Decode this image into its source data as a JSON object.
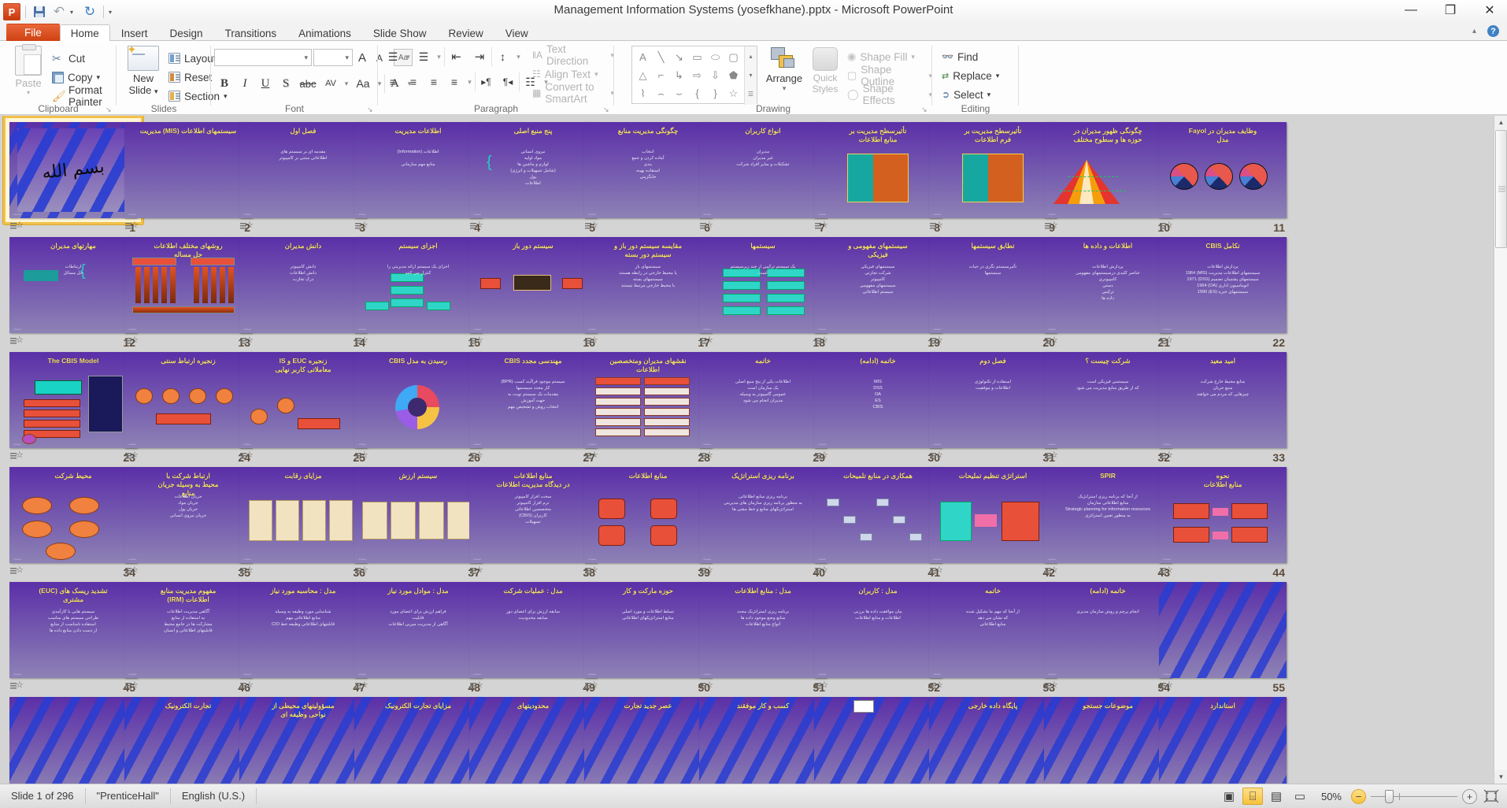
{
  "window": {
    "title": "Management Information Systems (yosefkhane).pptx  -  Microsoft PowerPoint",
    "minimize": "—",
    "restore": "❐",
    "close": "✕"
  },
  "qat": {
    "app_logo": "P",
    "save": "save-icon",
    "undo": "↶",
    "undo_caret": "▾",
    "redo": "↻",
    "customize": "▾"
  },
  "ribbon": {
    "help_collapse": "▴",
    "help": "?",
    "tabs": [
      {
        "label": "File",
        "active": false,
        "kind": "file"
      },
      {
        "label": "Home",
        "active": true,
        "kind": "normal"
      },
      {
        "label": "Insert",
        "active": false,
        "kind": "normal"
      },
      {
        "label": "Design",
        "active": false,
        "kind": "normal"
      },
      {
        "label": "Transitions",
        "active": false,
        "kind": "normal"
      },
      {
        "label": "Animations",
        "active": false,
        "kind": "normal"
      },
      {
        "label": "Slide Show",
        "active": false,
        "kind": "normal"
      },
      {
        "label": "Review",
        "active": false,
        "kind": "normal"
      },
      {
        "label": "View",
        "active": false,
        "kind": "normal"
      }
    ],
    "groups": {
      "clipboard": {
        "label": "Clipboard",
        "paste": "Paste",
        "paste_caret": "▾",
        "cut": "Cut",
        "copy": "Copy",
        "copy_caret": "▾",
        "format_painter": "Format Painter",
        "dialog_launcher": "↘"
      },
      "slides": {
        "label": "Slides",
        "new_slide": "New",
        "new_slide2": "Slide",
        "new_slide_caret": "▾",
        "layout": "Layout",
        "layout_caret": "▾",
        "reset": "Reset",
        "section": "Section",
        "section_caret": "▾"
      },
      "font": {
        "label": "Font",
        "font_name_value": "",
        "font_size_value": "",
        "caret": "▾",
        "grow_font": "A",
        "shrink_font": "A",
        "clear_formatting": "Aa",
        "bold": "B",
        "italic": "I",
        "underline": "U",
        "shadow": "S",
        "strikethrough": "abc",
        "character_spacing": "AV",
        "change_case": "Aa",
        "font_color": "A",
        "dialog_launcher": "↘"
      },
      "paragraph": {
        "label": "Paragraph",
        "bullets": "☰",
        "numbering": "☰",
        "decrease_indent": "⇤",
        "increase_indent": "⇥",
        "line_spacing": "↕",
        "align_left": "≡",
        "align_center": "≡",
        "align_right": "≡",
        "justify": "≡",
        "ltr": "▸¶",
        "rtl": "¶◂",
        "columns": "☷",
        "text_direction": "Text Direction",
        "align_text": "Align Text",
        "convert_to_smartart": "Convert to SmartArt",
        "caret": "▾",
        "dialog_launcher": "↘"
      },
      "drawing": {
        "label": "Drawing",
        "shapes": [
          "textbox-shape",
          "line-shape",
          "arrow-shape",
          "rectangle-shape",
          "oval-shape",
          "rounded-rect-shape",
          "triangle-shape",
          "elbow-connector-shape",
          "elbow-arrow-shape",
          "right-arrow-shape",
          "down-arrow-shape",
          "pentagon-shape",
          "freeform-shape",
          "curve-shape",
          "arc-shape",
          "left-brace-shape",
          "right-brace-shape",
          "star-shape"
        ],
        "scroll_up": "▴",
        "scroll_down": "▾",
        "more": "☰",
        "arrange": "Arrange",
        "arrange_caret": "▾",
        "quick_styles": "Quick",
        "quick_styles2": "Styles",
        "quick_styles_caret": "▾",
        "shape_fill": "Shape Fill",
        "shape_outline": "Shape Outline",
        "shape_effects": "Shape Effects",
        "caret": "▾",
        "dialog_launcher": "↘"
      },
      "editing": {
        "label": "Editing",
        "find": "Find",
        "replace": "Replace",
        "select": "Select",
        "caret": "▾"
      }
    }
  },
  "status": {
    "slide_count": "Slide 1 of 296",
    "theme": "\"PrenticeHall\"",
    "language": "English (U.S.)",
    "views": [
      {
        "name": "normal-view-button",
        "glyph": "▣",
        "active": false
      },
      {
        "name": "slide-sorter-view-button",
        "glyph": "⌸",
        "active": true
      },
      {
        "name": "reading-view-button",
        "glyph": "▤",
        "active": false
      },
      {
        "name": "slide-show-button",
        "glyph": "▭",
        "active": false
      }
    ],
    "zoom_level": "50%",
    "zoom_out": "−",
    "zoom_in": "+",
    "fit_to_window": "⤢"
  },
  "thumbnail_pane": {
    "columns": 11,
    "selected_slide": 1,
    "scrollbar": {
      "up": "▲",
      "down": "▼"
    },
    "slides": [
      {
        "n": 1,
        "title": "",
        "body": "",
        "art": "calligraphy",
        "stripes": true,
        "selected": true
      },
      {
        "n": 2,
        "title": "سیستمهای اطلاعات (MIS) مدیریت",
        "body": "",
        "art": "none",
        "stripes": false
      },
      {
        "n": 3,
        "title": "فصل اول",
        "body": "مقدمه ای بر سیستم های\nاطلاعاتی مبتنی بر کامپیوتر",
        "art": "none",
        "stripes": false
      },
      {
        "n": 4,
        "title": "اطلاعات مدیریت",
        "body": "اطلاعات (Information)\n\nمنابع مهم سازمانی",
        "art": "none",
        "stripes": false
      },
      {
        "n": 5,
        "title": "پنج منبع اصلی",
        "body": "نیروی انسانی\nمواد اولیه\nلوازم و ماشین ها\n(شامل تسهیلات و انرژی)\nپول\nاطلاعات",
        "art": "brace",
        "stripes": false
      },
      {
        "n": 6,
        "title": "چگونگی مدیریت منابع",
        "body": "انتخاب\nآماده کردن و جمع\nبندی\nاستفاده بهینه\nجایگزینی",
        "art": "none",
        "stripes": false
      },
      {
        "n": 7,
        "title": "انواع کاربران",
        "body": "مدیران\nغیر مدیران\nتشکیلات و سایر افراد شرکت",
        "art": "none",
        "stripes": false
      },
      {
        "n": 8,
        "title": "تأثیرسطح مدیریت بر\nمنابع اطلاعات",
        "body": "",
        "art": "matrix",
        "stripes": false
      },
      {
        "n": 9,
        "title": "تأثیرسطح مدیریت بر\nفرم اطلاعات",
        "body": "",
        "art": "matrix",
        "stripes": false
      },
      {
        "n": 10,
        "title": "چگونگی ظهور مدیران در\nحوزه ها و سطوح مختلف",
        "body": "",
        "art": "pyramid",
        "stripes": false
      },
      {
        "n": 11,
        "title": "وظایف مدیران در Fayol\nمدل",
        "body": "",
        "art": "pies",
        "stripes": false
      },
      {
        "n": 12,
        "title": "مهارتهای مدیران",
        "body": "ارتباطات\nحل مسائل",
        "art": "brace2",
        "stripes": false
      },
      {
        "n": 13,
        "title": "روشهای مختلف اطلاعات\nحل مساله",
        "body": "",
        "art": "rockets",
        "stripes": false
      },
      {
        "n": 14,
        "title": "دانش مدیران",
        "body": "دانش کامپیوتر\nدانش اطلاعات\nدرک تجارت",
        "art": "none",
        "stripes": false
      },
      {
        "n": 15,
        "title": "اجزای سیستم",
        "body": "اجزای یک سیستم ارائه مدیریتی را\nکنترل می کنند",
        "art": "org",
        "stripes": false
      },
      {
        "n": 16,
        "title": "سیستم دور باز",
        "body": "",
        "art": "flow",
        "stripes": false
      },
      {
        "n": 17,
        "title": "مقایسه سیستم دور باز و\nسیستم دور بسته",
        "body": "سیستمهای باز\nیا محیط خارجی در رابطه هستند\nسیستمهای بسته\nبا محیط خارجی مرتبط نیستند",
        "art": "none",
        "stripes": false
      },
      {
        "n": 18,
        "title": "سیستمها",
        "body": "یک سیستم ترکیبی از چند زیرسیستم\nاست",
        "art": "org2",
        "stripes": false
      },
      {
        "n": 19,
        "title": "سیستمهای مفهومی و\nفیزیکی",
        "body": "سیستمهای فیزیکی\nشرکت تجارتی\nکامپیوتر\nسیستمهای مفهومی\nسیستم اطلاعاتی",
        "art": "none",
        "stripes": false
      },
      {
        "n": 20,
        "title": "تطابق سیستمها",
        "body": "تأثیرسیستم نگری در حیات\nسیستمها",
        "art": "none",
        "stripes": false
      },
      {
        "n": 21,
        "title": "اطلاعات و داده ها",
        "body": "پردازش اطلاعات\nعناصر کلیدی درسیستمهای مفهومی\nکامپیوتری\nدستی\nترکیبی\nداده ها",
        "art": "none",
        "stripes": false
      },
      {
        "n": 22,
        "title": "تکامل CBIS",
        "body": "پردازش اطلاعات\nسیستمهای اطلاعات مدیریت (MIS) 1964\nسیستمهای پشتیبان تصمیم (DSS) 1971\nاتوماسیون اداری (OA) 1964\nسیستمهای خبره (ES) 1990",
        "art": "none",
        "stripes": false
      },
      {
        "n": 23,
        "title": "The CBIS Model",
        "body": "",
        "art": "cbis",
        "stripes": false
      },
      {
        "n": 24,
        "title": "زنجیره ارتباط سنتی",
        "body": "",
        "art": "chain",
        "stripes": false
      },
      {
        "n": 25,
        "title": "زنجیره EUC و IS\nمعاملاتی کاربر نهایی",
        "body": "",
        "art": "chain2",
        "stripes": false
      },
      {
        "n": 26,
        "title": "رسیدن به مدل CBIS",
        "body": "",
        "art": "donut",
        "stripes": false
      },
      {
        "n": 27,
        "title": "مهندسی مجدد CBIS",
        "body": "سیستم موجود فراآیند کسب (BPR)\nکار مجدد سیستمها\nمقدمات یک سیستم نوبت به\nجهت آموزش\nانتخاب روش و تشخیص مهم",
        "art": "none",
        "stripes": false
      },
      {
        "n": 28,
        "title": "نقشهای مدیران ومتخصصین\nاطلاعات",
        "body": "",
        "art": "table",
        "stripes": false
      },
      {
        "n": 29,
        "title": "خاتمه",
        "body": "اطلاعات یکی از پنج منبع اصلی\nیک سازمان است\nعمومی گامپیوتر به وسیله\nمدیران انجام می شود",
        "art": "none",
        "stripes": false
      },
      {
        "n": 30,
        "title": "خاتمه (ادامه)",
        "body": "MIS\nDSS\nOA\nES\nCBIS",
        "art": "none",
        "stripes": false
      },
      {
        "n": 31,
        "title": "فصل دوم",
        "body": "استفاده از تکنولوژی\nاطلاعات و موفقیت",
        "art": "none",
        "stripes": false
      },
      {
        "n": 32,
        "title": "شرکت چیست ؟",
        "body": "سیستمی فیزیکی است\nکه از طریق منابع مدیریت می شود",
        "art": "none",
        "stripes": false
      },
      {
        "n": 33,
        "title": "امید معید",
        "body": "منابع محیط خارج شرکت\nمنبع جریان\nچیزهایی که مردم می خواهند",
        "art": "none",
        "stripes": false
      },
      {
        "n": 34,
        "title": "محیط شرکت",
        "body": "",
        "art": "ovals",
        "stripes": false
      },
      {
        "n": 35,
        "title": "ارتباط شرکت با\nمحیط به وسیله جریان\nمنابع",
        "body": "جریان اطلاعات\nجریان مواد\nجریان پول\nجریان نیروی انسانی",
        "art": "none",
        "stripes": false
      },
      {
        "n": 36,
        "title": "مزایای رقابت",
        "body": "",
        "art": "cards",
        "stripes": false
      },
      {
        "n": 37,
        "title": "سیستم ارزش",
        "body": "",
        "art": "cards2",
        "stripes": false
      },
      {
        "n": 38,
        "title": "منابع اطلاعات\nدر دیدگاه مدیریت اطلاعات",
        "body": "سخت افزار کامپیوتر\nنرم افزار کامپیوتر\nمتخصصین اطلاعاتی\nکاربران (CBIS)\nتسهیلات",
        "art": "none",
        "stripes": false
      },
      {
        "n": 39,
        "title": "منابع اطلاعات",
        "body": "",
        "art": "cylinders",
        "stripes": false
      },
      {
        "n": 40,
        "title": "برنامه ریزی استراتژیک",
        "body": "برنامه ریزی منابع اطلاعاتی\nبه منظور برنامه ریزی سازمان های مدیریتی\nاستراتژیکهای منابع و خط مشی ها",
        "art": "none",
        "stripes": false
      },
      {
        "n": 41,
        "title": "همکاری در منابع تلمیحات",
        "body": "",
        "art": "network",
        "stripes": false
      },
      {
        "n": 42,
        "title": "استراتژی تنظیم تملیحات",
        "body": "",
        "art": "arrowflow",
        "stripes": false
      },
      {
        "n": 43,
        "title": "SPIR",
        "body": "از آنجا که برنامه ریزی استراتژیک\nمنابع اطلاعاتی سازمان\nStrategic planning for information resources\nبه منظور تعیین استراتژی",
        "art": "none",
        "stripes": false
      },
      {
        "n": 44,
        "title": "نحوه\nمنابع اطلاعات",
        "body": "",
        "art": "arrowboxes",
        "stripes": false
      },
      {
        "n": 45,
        "title": "تشدید ریسک های (EUC)\nمشتری",
        "body": "سیستم هایی با کارآمدی\nطراحی سیستم های مناسب\nاستفاده نامناسب از منابع\nاز دست دادن منابع داده ها",
        "art": "none",
        "stripes": false
      },
      {
        "n": 46,
        "title": "مفهوم مدیریت منابع\nاطلاعات (IRM)",
        "body": "آگاهی مدیریت اطلاعات\nبه استفاده از منابع\nمشارکت ها در جامع محیط\nقابلیتهای اطلاعاتی و انسان",
        "art": "none",
        "stripes": false
      },
      {
        "n": 47,
        "title": "مدل : محاسبه مورد نیاز",
        "body": "شناسایی مورد وظیفه به وسیله\nمنابع اطلاعاتی مهم\nقابلیتهای اطلاعاتی وظیفه خط CIO",
        "art": "none",
        "stripes": false
      },
      {
        "n": 48,
        "title": "مدل : موادل مورد نیاز",
        "body": "فراهم ارزش برای اعضای مورد\nقابلیت\nآگاهی از مدیریت میربی اطلاعات",
        "art": "none",
        "stripes": false
      },
      {
        "n": 49,
        "title": "مدل : عملیات شرکت",
        "body": "سابقه ارزش برای اعضای دور\nسابقه محدودیت",
        "art": "none",
        "stripes": false
      },
      {
        "n": 50,
        "title": "حوزه مارکت و کار",
        "body": "تسلط اطلاعات و مورد اصلی\nمنابع استراتژیکهای اطلاعاتی",
        "art": "none",
        "stripes": false
      },
      {
        "n": 51,
        "title": "مدل : منابع اطلاعات",
        "body": "برنامه ریزی استراتژیک مجدد\nمنابع وضع موجود داده ها\nانواع منابع اطلاعات",
        "art": "none",
        "stripes": false
      },
      {
        "n": 52,
        "title": "مدل : کاربران",
        "body": "بیان موافقت داده ها برزنی\nاطلاعات و منابع اطلاعات",
        "art": "none",
        "stripes": false
      },
      {
        "n": 53,
        "title": "خاتمه",
        "body": "از آنجا که مهم ما تشکیل شده\nکه نشان می دهد\nمنابع اطلاعاتی",
        "art": "none",
        "stripes": false
      },
      {
        "n": 54,
        "title": "خاتمه (ادامه)",
        "body": "انجام پرچم و روش سازمان مدیری",
        "art": "none",
        "stripes": false
      },
      {
        "n": 55,
        "title": "",
        "body": "",
        "art": "none",
        "stripes": true
      },
      {
        "n": 56,
        "title": "",
        "body": "",
        "art": "none",
        "stripes": true
      },
      {
        "n": 57,
        "title": "تجارت الکترونیک",
        "body": "",
        "art": "none",
        "stripes": true
      },
      {
        "n": 58,
        "title": "مسؤولیتهای محیطی از\nنواحی وظیفه ای",
        "body": "",
        "art": "none",
        "stripes": true
      },
      {
        "n": 59,
        "title": "مزایای تجارت الکترونیک",
        "body": "",
        "art": "none",
        "stripes": true
      },
      {
        "n": 60,
        "title": "محدودیتهای",
        "body": "",
        "art": "none",
        "stripes": true
      },
      {
        "n": 61,
        "title": "عصر جدید تجارت",
        "body": "",
        "art": "none",
        "stripes": true
      },
      {
        "n": 62,
        "title": "کسب و کار موفقند",
        "body": "",
        "art": "none",
        "stripes": true
      },
      {
        "n": 63,
        "title": "",
        "body": "",
        "art": "whitebox",
        "stripes": true
      },
      {
        "n": 64,
        "title": "پایگاه داده خارجی",
        "body": "",
        "art": "none",
        "stripes": true
      },
      {
        "n": 65,
        "title": "موضوعات جستجو",
        "body": "",
        "art": "none",
        "stripes": true
      },
      {
        "n": 66,
        "title": "استاندارد",
        "body": "",
        "art": "none",
        "stripes": true
      }
    ]
  }
}
